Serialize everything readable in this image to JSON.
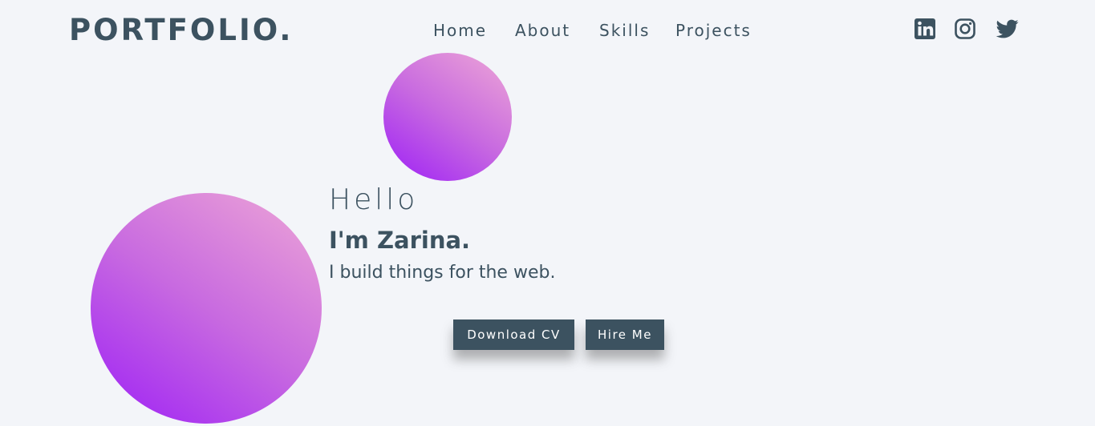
{
  "header": {
    "logo": "PORTFOLIO.",
    "nav": [
      {
        "label": "Home"
      },
      {
        "label": "About"
      },
      {
        "label": "Skills"
      },
      {
        "label": "Projects"
      }
    ],
    "social": [
      {
        "icon": "linkedin-icon"
      },
      {
        "icon": "instagram-icon"
      },
      {
        "icon": "twitter-icon"
      }
    ]
  },
  "hero": {
    "greeting": "Hello",
    "name": "I'm Zarina.",
    "tagline": "I build things for the web.",
    "buttons": {
      "download_cv": "Download CV",
      "hire_me": "Hire Me"
    }
  },
  "colors": {
    "background": "#f3f5f9",
    "text_primary": "#3c5260",
    "button_bg": "#3c5260",
    "button_text": "#ffffff",
    "gradient_start": "#9d1ff6",
    "gradient_end": "#eea7d6"
  }
}
